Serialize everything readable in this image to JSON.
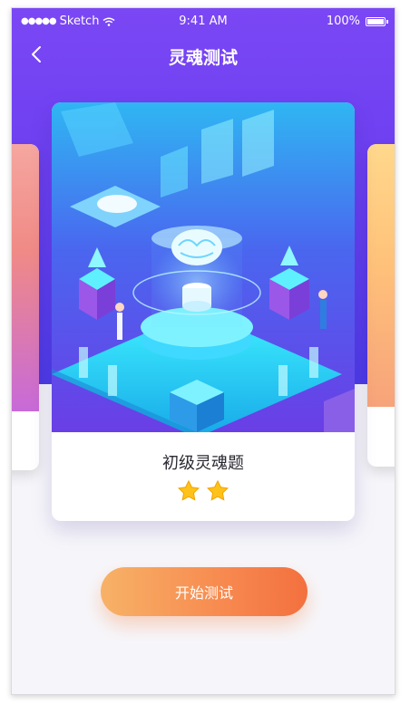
{
  "status_bar": {
    "carrier": "Sketch",
    "time": "9:41 AM",
    "battery": "100%"
  },
  "nav": {
    "title": "灵魂测试",
    "back_icon": "chevron-left-icon"
  },
  "carousel": {
    "current_card": {
      "label": "初级灵魂题",
      "rating": 2,
      "star_icon": "star-icon"
    }
  },
  "actions": {
    "start_label": "开始测试"
  },
  "colors": {
    "header_gradient_top": "#7b47f5",
    "header_gradient_bottom": "#4d3be8",
    "button_start": "#f7b267",
    "button_end": "#f3703f",
    "star": "#ffc21a"
  }
}
